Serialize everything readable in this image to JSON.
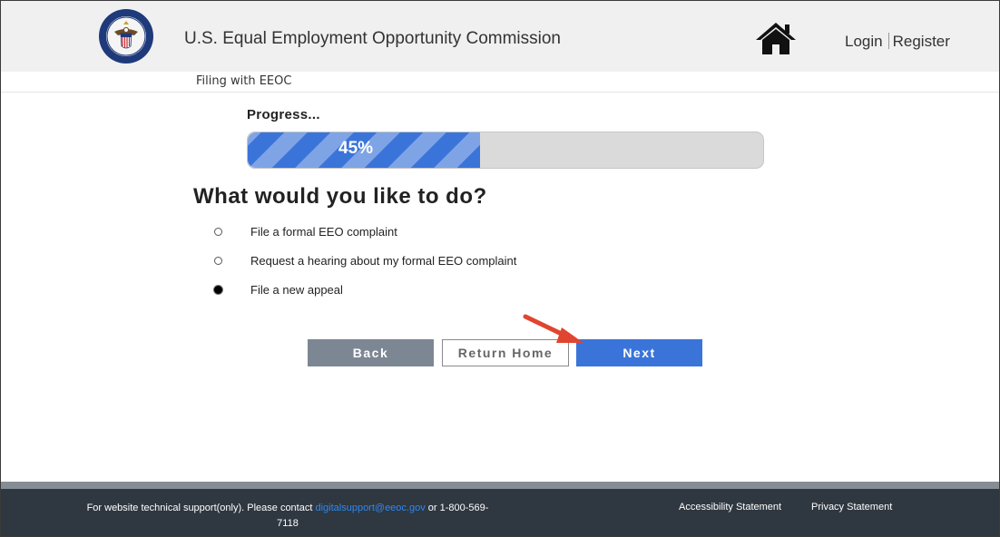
{
  "header": {
    "title": "U.S. Equal Employment Opportunity Commission",
    "login": "Login",
    "register": "Register"
  },
  "breadcrumb": "Filing with EEOC",
  "progress": {
    "label": "Progress...",
    "percent": 45,
    "text": "45%",
    "color": "#3b74d9"
  },
  "question": "What would you like to do?",
  "options": [
    {
      "label": "File a formal EEO complaint",
      "selected": false
    },
    {
      "label": "Request a hearing about my formal EEO complaint",
      "selected": false
    },
    {
      "label": "File a new appeal",
      "selected": true
    }
  ],
  "buttons": {
    "back": "Back",
    "return_home": "Return Home",
    "next": "Next"
  },
  "footer": {
    "support_text": "For website technical support(only). Please contact",
    "support_email": "digitalsupport@eeoc.gov",
    "support_or": "or 1-800-569-7118",
    "accessibility": "Accessibility Statement",
    "privacy": "Privacy Statement"
  },
  "colors": {
    "primary": "#3b74d9",
    "back_button": "#7d8793",
    "footer_bg": "#2f3740",
    "annotation_arrow": "#e0452f"
  },
  "icons": [
    "eeoc-seal-logo",
    "home-icon",
    "annotation-arrow"
  ]
}
